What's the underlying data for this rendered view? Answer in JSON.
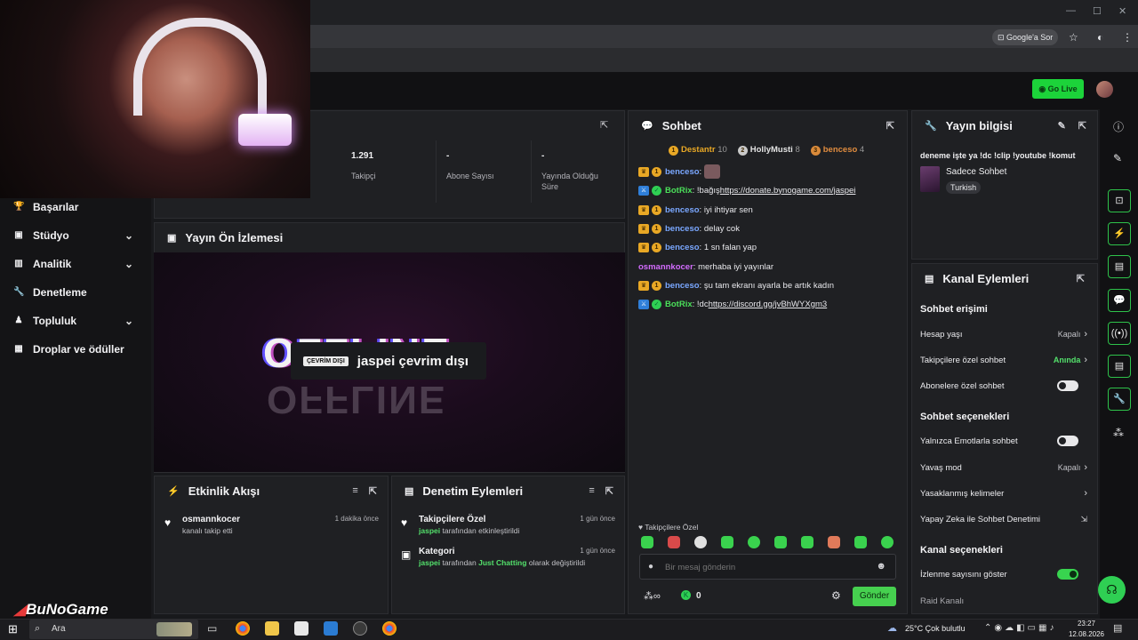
{
  "browser": {
    "sor_label": "Google'a Sor"
  },
  "topnav": {
    "golive_label": "Go Live"
  },
  "sidebar": {
    "items": [
      {
        "label": "Başarılar"
      },
      {
        "label": "Stüdyo"
      },
      {
        "label": "Analitik"
      },
      {
        "label": "Denetleme"
      },
      {
        "label": "Topluluk"
      },
      {
        "label": "Droplar ve ödüller"
      }
    ]
  },
  "stats": [
    {
      "value": "1.291",
      "label": "Takipçi"
    },
    {
      "value": "-",
      "label": "Abone Sayısı"
    },
    {
      "value": "-",
      "label": "Yayında Olduğu Süre"
    }
  ],
  "preview": {
    "title": "Yayın Ön İzlemesi",
    "offline_badge": "ÇEVRİM DIŞI",
    "offline_text": "jaspei çevrim dışı",
    "bg_text": "OFFLINE"
  },
  "activity": {
    "title": "Etkinlik Akışı",
    "items": [
      {
        "user": "osmannkocer",
        "sub": "kanalı takip etti",
        "time": "1 dakika önce"
      }
    ]
  },
  "moderation": {
    "title": "Denetim Eylemleri",
    "items": [
      {
        "title": "Takipçilere Özel",
        "actor": "jaspei",
        "sub": "tarafından etkinleştirildi",
        "time": "1 gün önce"
      },
      {
        "title": "Kategori",
        "actor": "jaspei",
        "sub_pre": "tarafından",
        "category": "Just Chatting",
        "sub_post": "olarak değiştirildi",
        "time": "1 gün önce"
      }
    ]
  },
  "chat": {
    "title": "Sohbet",
    "top": [
      {
        "name": "Destantr",
        "count": "10",
        "rank": "1"
      },
      {
        "name": "HollyMusti",
        "count": "8",
        "rank": "2"
      },
      {
        "name": "benceso",
        "count": "4",
        "rank": "3"
      }
    ],
    "messages": [
      {
        "user": "benceso",
        "text": ""
      },
      {
        "user": "BotRix",
        "text": "!bağış ",
        "link": "https://donate.bynogame.com/jaspei"
      },
      {
        "user": "benceso",
        "text": "iyi ihtiyar sen"
      },
      {
        "user": "benceso",
        "text": "delay cok"
      },
      {
        "user": "benceso",
        "text": "1 sn falan yap"
      },
      {
        "user": "osmannkocer",
        "text": "merhaba iyi yayınlar"
      },
      {
        "user": "benceso",
        "text": "şu tam ekranı ayarla be artık kadın"
      },
      {
        "user": "BotRix",
        "text": "!dc ",
        "link": "https://discord.gg/jvBhWYXgm3"
      }
    ],
    "mode_label": "Takipçilere Özel",
    "input_placeholder": "Bir mesaj gönderin",
    "kick_count": "0",
    "send_label": "Gönder"
  },
  "stream_info": {
    "title": "Yayın bilgisi",
    "stream_title": "deneme işte ya !dc !clip !youtube !komut",
    "category": "Sadece Sohbet",
    "tag": "Turkish"
  },
  "channel_actions": {
    "title": "Kanal Eylemleri",
    "chat_access": "Sohbet erişimi",
    "account_age": "Hesap yaşı",
    "account_age_val": "Kapalı",
    "followers_only": "Takipçilere özel sohbet",
    "followers_only_val": "Anında",
    "subs_only": "Abonelere özel sohbet",
    "chat_options": "Sohbet seçenekleri",
    "emote_only": "Yalnızca Emotlarla sohbet",
    "slow_mode": "Yavaş mod",
    "slow_mode_val": "Kapalı",
    "banned_words": "Yasaklanmış kelimeler",
    "ai_moderation": "Yapay Zeka ile Sohbet Denetimi",
    "channel_options": "Kanal seçenekleri",
    "show_viewers": "İzlenme sayısını göster",
    "raid": "Raid Kanalı"
  },
  "watermark": "BuNoGame",
  "taskbar": {
    "search": "Ara",
    "weather": "25°C  Çok bulutlu",
    "time": "23:27",
    "date": "12.08.2026"
  },
  "colors": {
    "accent": "#1cd33a",
    "panel": "#1f2023",
    "bg": "#18191c"
  }
}
